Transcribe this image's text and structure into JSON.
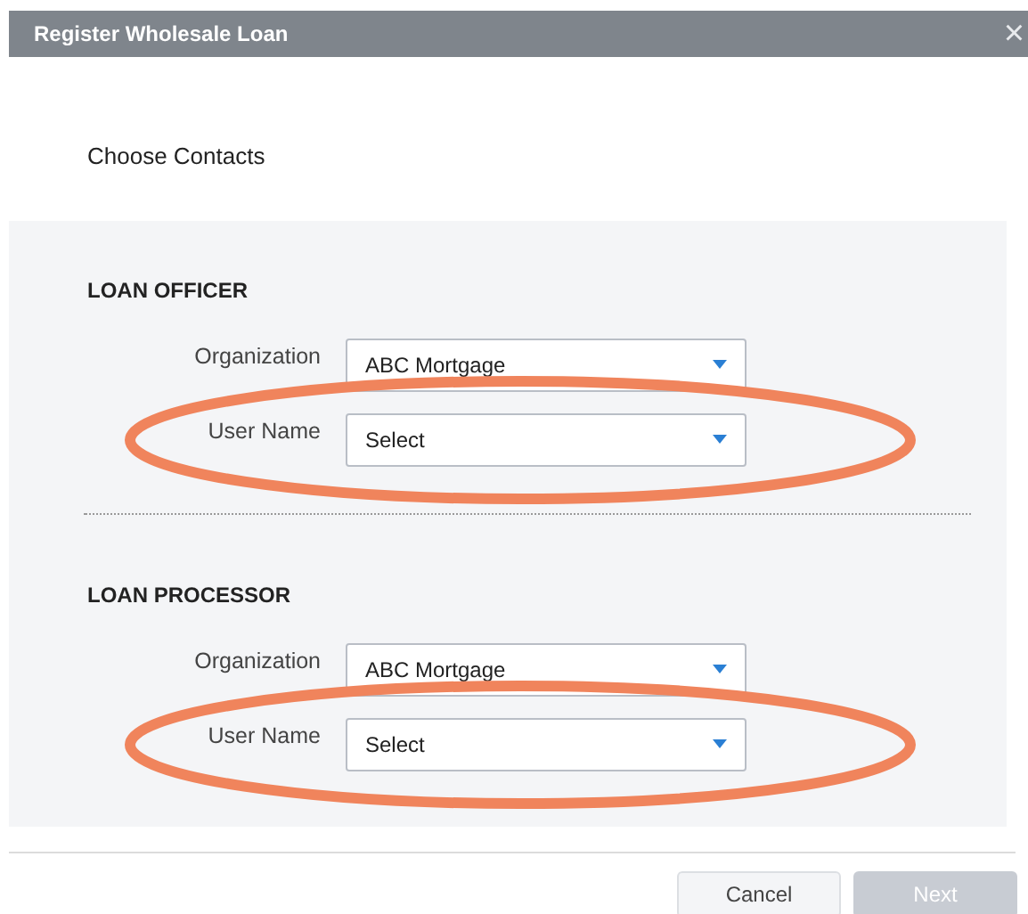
{
  "window": {
    "title": "Register Wholesale Loan",
    "close": "×"
  },
  "heading": "Choose Contacts",
  "sections": [
    {
      "title": "LOAN OFFICER",
      "fields": [
        {
          "label": "Organization",
          "value": "ABC Mortgage",
          "highlighted": false
        },
        {
          "label": "User Name",
          "value": "Select",
          "highlighted": true
        }
      ]
    },
    {
      "title": "LOAN PROCESSOR",
      "fields": [
        {
          "label": "Organization",
          "value": "ABC Mortgage",
          "highlighted": false
        },
        {
          "label": "User Name",
          "value": "Select",
          "highlighted": true
        }
      ]
    }
  ],
  "buttons": [
    {
      "label": "Cancel",
      "disabled": false
    },
    {
      "label": "Next",
      "disabled": true
    }
  ]
}
